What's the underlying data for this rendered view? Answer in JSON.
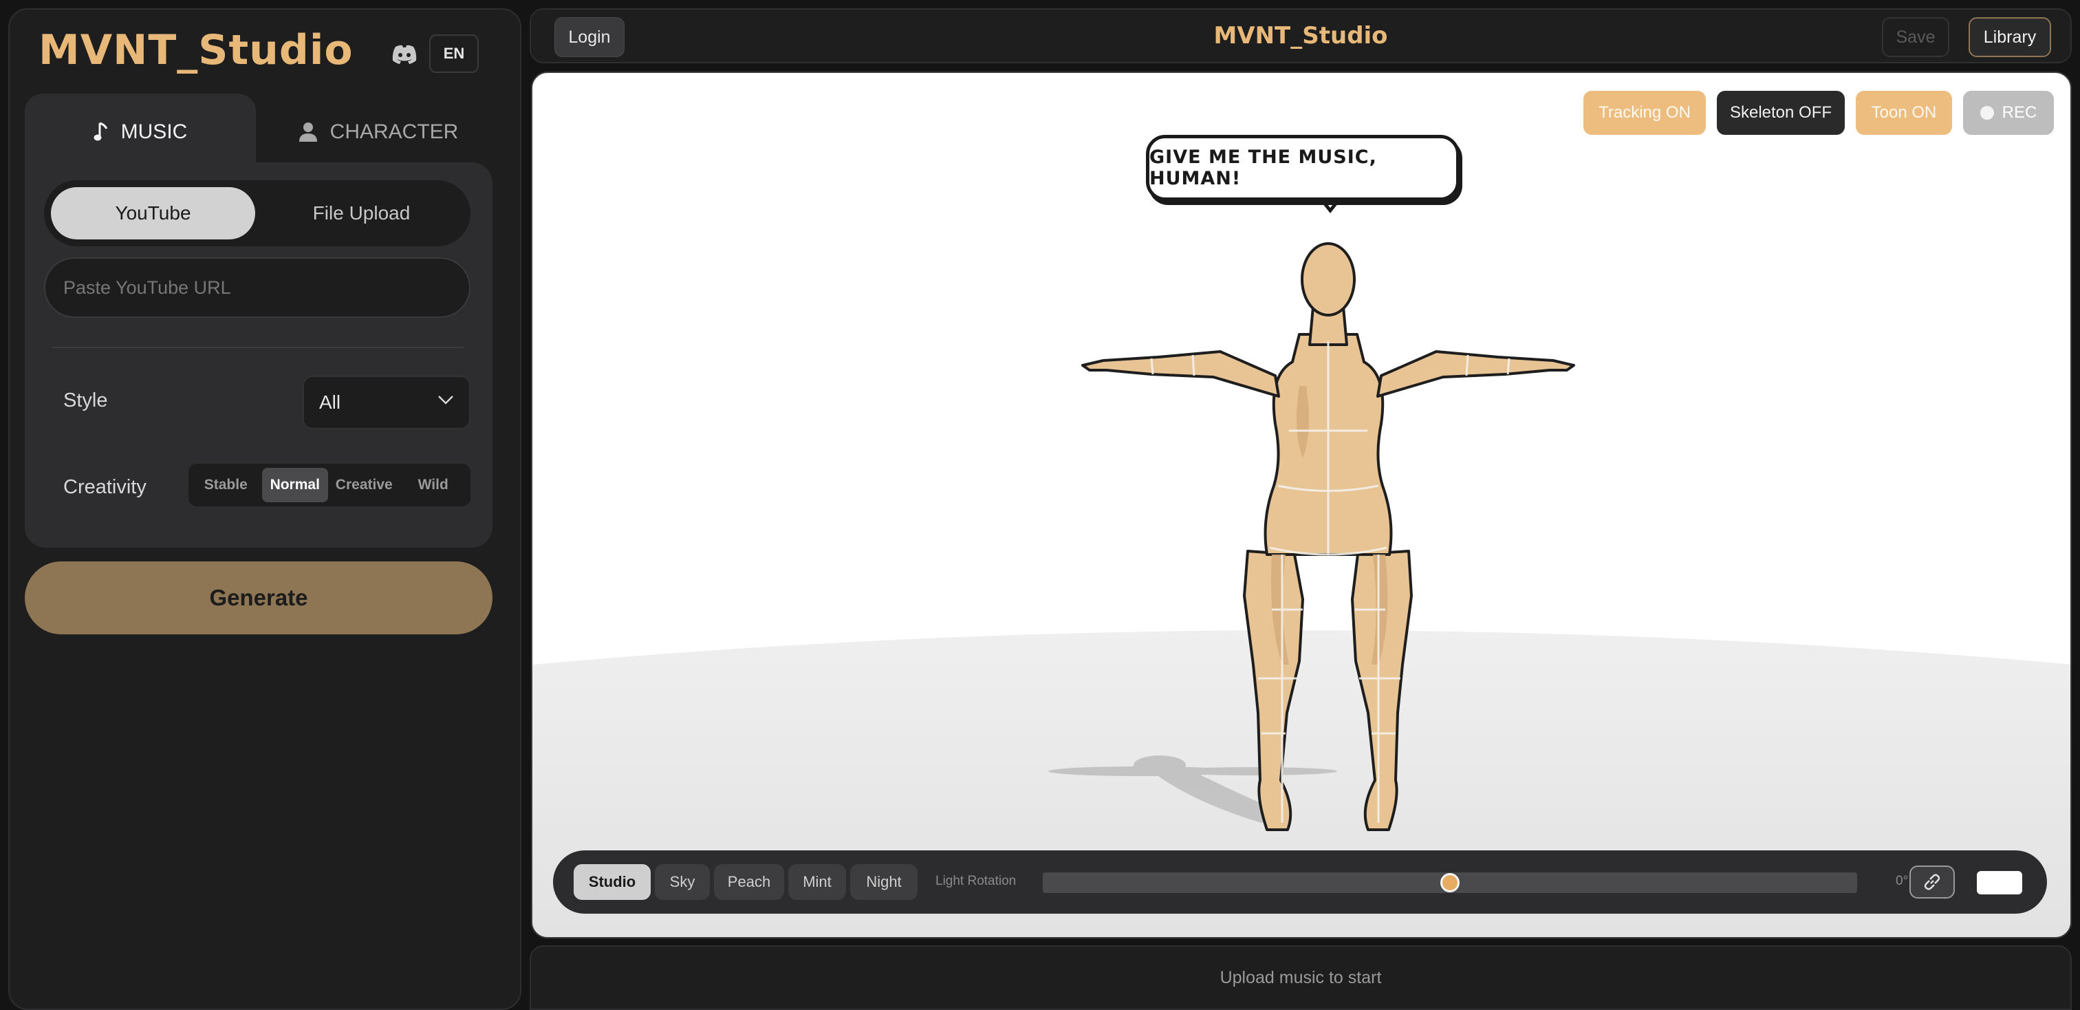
{
  "brand": {
    "name": "MVNT_Studio",
    "lang": "EN"
  },
  "tabs": {
    "music": "MUSIC",
    "character": "CHARACTER"
  },
  "music": {
    "source_options": [
      "YouTube",
      "File Upload"
    ],
    "source_selected": "YouTube",
    "url_placeholder": "Paste YouTube URL",
    "style_label": "Style",
    "style_value": "All",
    "creativity_label": "Creativity",
    "creativity_options": [
      "Stable",
      "Normal",
      "Creative",
      "Wild"
    ],
    "creativity_selected": "Normal",
    "generate_label": "Generate"
  },
  "topbar": {
    "login": "Login",
    "title": "MVNT_Studio",
    "save": "Save",
    "library": "Library"
  },
  "viewport": {
    "toggles": {
      "tracking": "Tracking ON",
      "skeleton": "Skeleton OFF",
      "toon": "Toon ON",
      "rec": "REC"
    },
    "speech": "GIVE ME THE MUSIC, HUMAN!",
    "environments": [
      "Studio",
      "Sky",
      "Peach",
      "Mint",
      "Night"
    ],
    "environment_selected": "Studio",
    "light_label": "Light Rotation",
    "light_value": 0.5,
    "light_degrees": "0°",
    "icons": {
      "discord": "discord-icon",
      "music": "music-note-icon",
      "character": "user-icon",
      "link": "link-icon",
      "chevron": "chevron-down-icon"
    }
  },
  "status": "Upload music to start",
  "colors": {
    "accent": "#e8b878",
    "generate": "#8e7553",
    "toggle_on": "#edbd7f",
    "skin": "#e8c494"
  }
}
